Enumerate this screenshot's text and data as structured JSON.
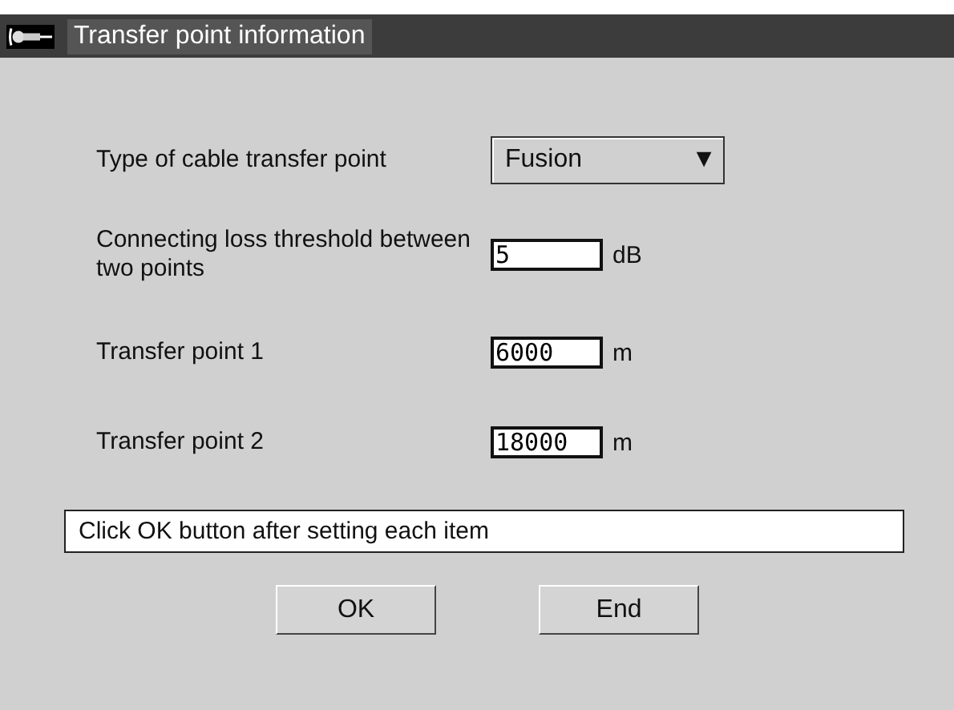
{
  "window": {
    "title": "Transfer point information"
  },
  "fields": [
    {
      "kind": "dropdown",
      "label": "Type of cable transfer point",
      "value": "Fusion",
      "arrow": "▼"
    },
    {
      "kind": "input",
      "label": "Connecting loss threshold between two points",
      "value": "5",
      "unit": "dB"
    },
    {
      "kind": "input",
      "label": "Transfer point 1",
      "value": "6000",
      "unit": "m"
    },
    {
      "kind": "input",
      "label": "Transfer point 2",
      "value": "18000",
      "unit": "m"
    }
  ],
  "message": "Click OK button after setting each item",
  "buttons": [
    "OK",
    "End"
  ]
}
